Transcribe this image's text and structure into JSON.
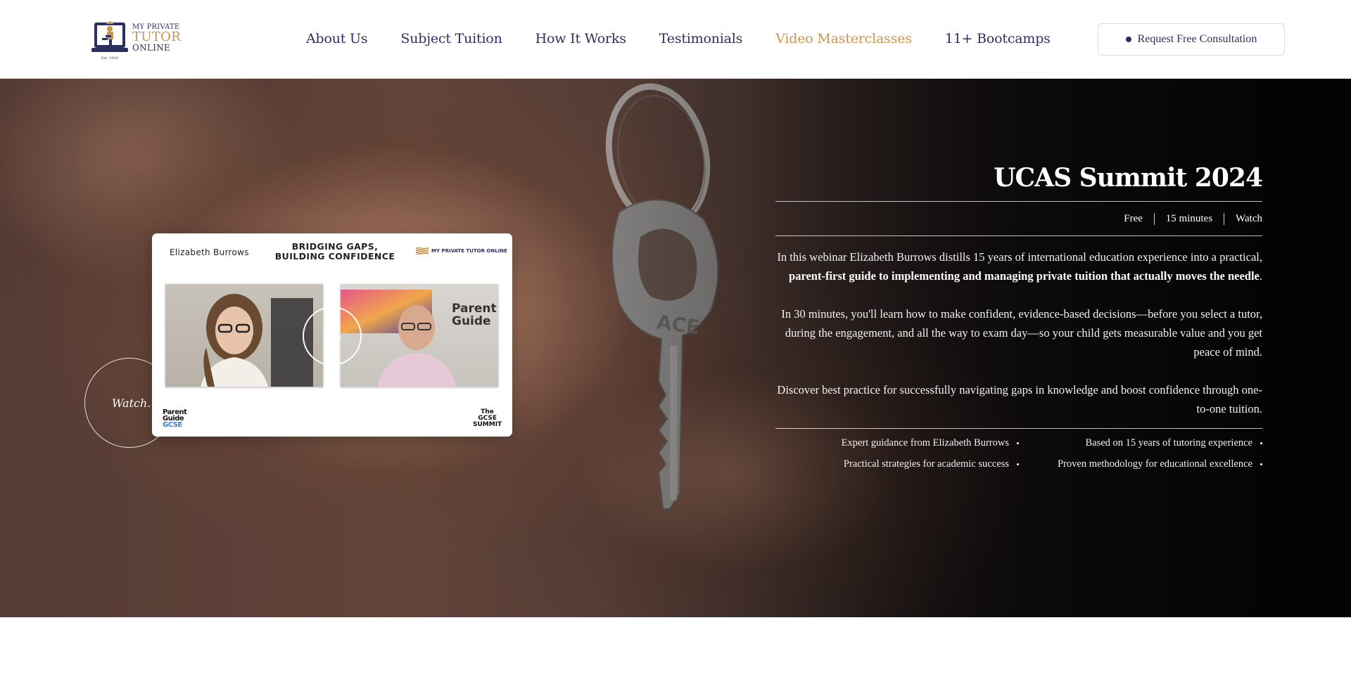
{
  "header": {
    "logo": {
      "line1": "MY PRIVATE",
      "line2": "TUTOR",
      "line3": "ONLINE",
      "est": "Est. 2016"
    },
    "nav": [
      {
        "label": "About Us"
      },
      {
        "label": "Subject Tuition"
      },
      {
        "label": "How It Works"
      },
      {
        "label": "Testimonials"
      },
      {
        "label": "Video Masterclasses",
        "active": true
      },
      {
        "label": "11+ Bootcamps"
      }
    ],
    "cta_label": "Request Free Consultation"
  },
  "hero": {
    "watch_label": "Watch.",
    "video": {
      "presenter": "Elizabeth Burrows",
      "title_line1": "BRIDGING GAPS,",
      "title_line2": "BUILDING CONFIDENCE",
      "brand": "MY PRIVATE TUTOR ONLINE",
      "partner_line1": "Parent",
      "partner_line2": "Guide",
      "partner_line3": "GCSE",
      "summit_line1": "The",
      "summit_line2": "GCSE",
      "summit_line3": "SUMMIT",
      "right_frame_logo_line1": "Parent",
      "right_frame_logo_line2": "Guide"
    },
    "title": "UCAS Summit 2024",
    "meta": [
      "Free",
      "15 minutes",
      "Watch"
    ],
    "para1_start": "In this webinar Elizabeth Burrows distills 15 years of international education experience into a practical, ",
    "para1_bold": "parent-first guide to implementing and managing private tuition that actually moves the needle",
    "para1_end": ".",
    "para2": "In 30 minutes, you'll learn how to make confident, evidence-based decisions—before you select a tutor, during the engagement, and all the way to exam day—so your child gets measurable value and you get peace of mind.",
    "para3": "Discover best practice for successfully navigating gaps in knowledge and boost confidence through one-to-one tuition.",
    "features": [
      "Expert guidance from Elizabeth Burrows",
      "Based on 15 years of tutoring experience",
      "Practical strategies for academic success",
      "Proven methodology for educational excellence"
    ]
  },
  "colors": {
    "navy": "#2d2f5e",
    "gold": "#c9954f"
  }
}
